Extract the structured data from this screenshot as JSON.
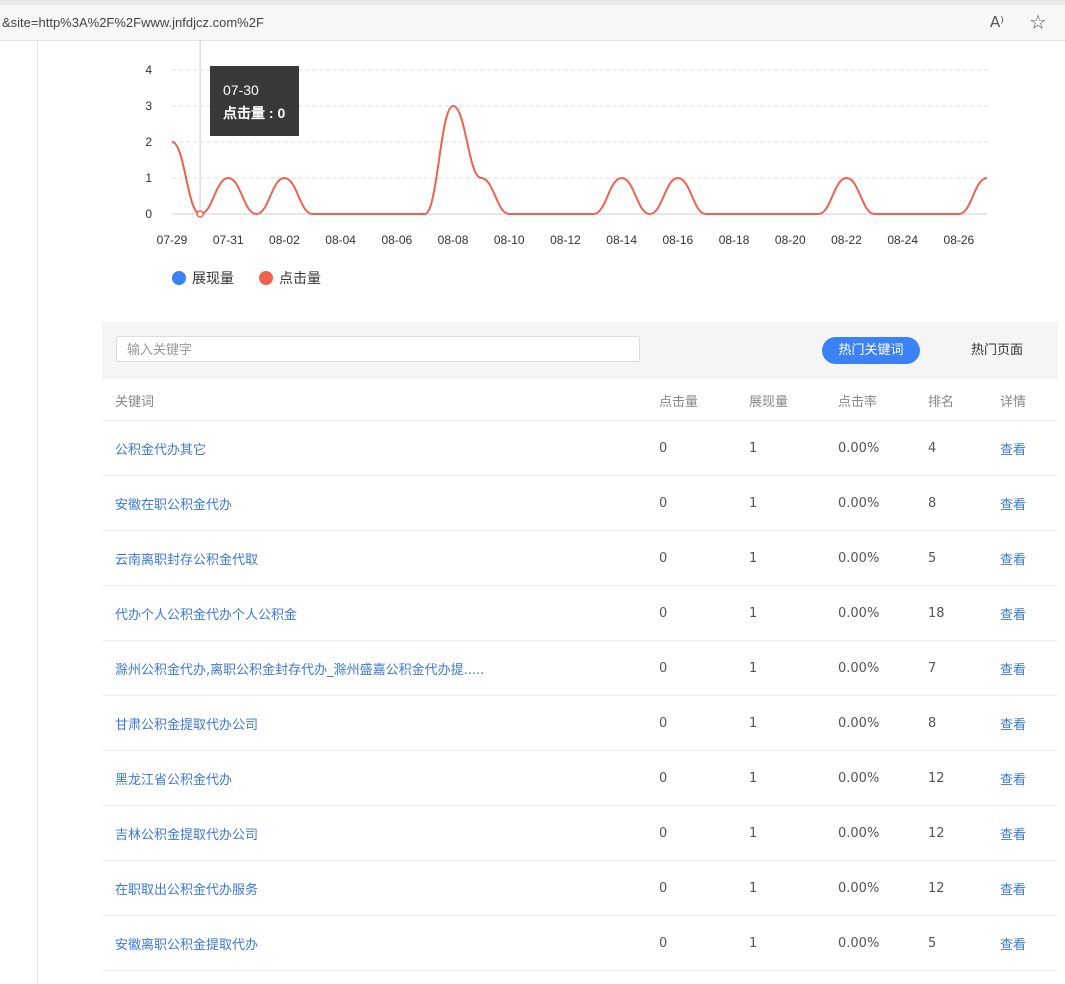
{
  "browser": {
    "url": "&site=http%3A%2F%2Fwww.jnfdjcz.com%2F",
    "read_aloud_icon": "A⁾",
    "favorite_icon": "☆"
  },
  "chart_data": {
    "type": "line",
    "x": [
      "07-29",
      "07-30",
      "07-31",
      "08-01",
      "08-02",
      "08-03",
      "08-04",
      "08-05",
      "08-06",
      "08-07",
      "08-08",
      "08-09",
      "08-10",
      "08-11",
      "08-12",
      "08-13",
      "08-14",
      "08-15",
      "08-16",
      "08-17",
      "08-18",
      "08-19",
      "08-20",
      "08-21",
      "08-22",
      "08-23",
      "08-24",
      "08-25",
      "08-26",
      "08-27"
    ],
    "x_tick_labels": [
      "07-29",
      "07-31",
      "08-02",
      "08-04",
      "08-06",
      "08-08",
      "08-10",
      "08-12",
      "08-14",
      "08-16",
      "08-18",
      "08-20",
      "08-22",
      "08-24",
      "08-26"
    ],
    "y_ticks": [
      0,
      1,
      2,
      3,
      4
    ],
    "ylim": [
      0,
      4
    ],
    "grid": true,
    "series": [
      {
        "name": "展现量",
        "color": "#3b82f6",
        "values": []
      },
      {
        "name": "点击量",
        "color": "#f0604f",
        "values": [
          2,
          0,
          1,
          0,
          1,
          0,
          0,
          0,
          0,
          0,
          3,
          1,
          0,
          0,
          0,
          0,
          1,
          0,
          1,
          0,
          0,
          0,
          0,
          0,
          1,
          0,
          0,
          0,
          0,
          1
        ]
      }
    ],
    "tooltip": {
      "date": "07-30",
      "label": "点击量 : 0"
    }
  },
  "legend": [
    {
      "label": "展现量",
      "color": "#3b82f6"
    },
    {
      "label": "点击量",
      "color": "#f0604f"
    }
  ],
  "toolbar": {
    "search_placeholder": "输入关键字",
    "primary_button": "热门关键词",
    "secondary_button": "热门页面"
  },
  "table": {
    "headers": [
      "关键词",
      "点击量",
      "展现量",
      "点击率",
      "排名",
      "详情"
    ],
    "rows": [
      {
        "keyword": "公积金代办其它",
        "clicks": "0",
        "impressions": "1",
        "ctr": "0.00%",
        "rank": "4",
        "detail": "查看"
      },
      {
        "keyword": "安徽在职公积金代办",
        "clicks": "0",
        "impressions": "1",
        "ctr": "0.00%",
        "rank": "8",
        "detail": "查看"
      },
      {
        "keyword": "云南离职封存公积金代取",
        "clicks": "0",
        "impressions": "1",
        "ctr": "0.00%",
        "rank": "5",
        "detail": "查看"
      },
      {
        "keyword": "代办个人公积金代办个人公积金",
        "clicks": "0",
        "impressions": "1",
        "ctr": "0.00%",
        "rank": "18",
        "detail": "查看"
      },
      {
        "keyword": "滁州公积金代办,离职公积金封存代办_滁州盛嘉公积金代办提.....",
        "clicks": "0",
        "impressions": "1",
        "ctr": "0.00%",
        "rank": "7",
        "detail": "查看"
      },
      {
        "keyword": "甘肃公积金提取代办公司",
        "clicks": "0",
        "impressions": "1",
        "ctr": "0.00%",
        "rank": "8",
        "detail": "查看"
      },
      {
        "keyword": "黑龙江省公积金代办",
        "clicks": "0",
        "impressions": "1",
        "ctr": "0.00%",
        "rank": "12",
        "detail": "查看"
      },
      {
        "keyword": "吉林公积金提取代办公司",
        "clicks": "0",
        "impressions": "1",
        "ctr": "0.00%",
        "rank": "12",
        "detail": "查看"
      },
      {
        "keyword": "在职取出公积金代办服务",
        "clicks": "0",
        "impressions": "1",
        "ctr": "0.00%",
        "rank": "12",
        "detail": "查看"
      },
      {
        "keyword": "安徽离职公积金提取代办",
        "clicks": "0",
        "impressions": "1",
        "ctr": "0.00%",
        "rank": "5",
        "detail": "查看"
      }
    ]
  }
}
